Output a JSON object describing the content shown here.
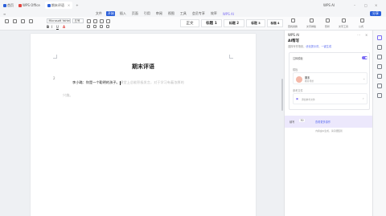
{
  "titlebar": {
    "home": "首页",
    "tabs": [
      {
        "label": "WPS Office"
      },
      {
        "label": "期末评语"
      }
    ],
    "right_text": "WPS AI"
  },
  "menu": {
    "items": [
      "文件",
      "开始",
      "插入",
      "页面",
      "引用",
      "审阅",
      "视图",
      "工具",
      "会员专享",
      "效率",
      "WPS AI"
    ],
    "active_index": 1,
    "share_label": "分享"
  },
  "ribbon": {
    "font_name": "Microsoft YaHei",
    "font_size": "五号",
    "styles": [
      "正文",
      "标题 1",
      "标题 2",
      "标题 3",
      "标题 4"
    ],
    "right_labels": [
      "查找替换",
      "文字排版",
      "形状",
      "文字工具",
      "公式"
    ]
  },
  "document": {
    "title": "期末评语",
    "para_number": "2",
    "line1_text": "李小璐：你是一个聪明的孩子。",
    "line1_ghost": "课堂上总能积极发言，对于学习有着浓厚的",
    "line2_ghost": "兴趣。"
  },
  "panel": {
    "header": "WPS AI",
    "title": "AI帮写",
    "subtitle_prefix": "选择写作场景，",
    "subtitle_link1": "优化提示词",
    "subtitle_link2": "一键生成",
    "card1_label": "注释模板",
    "card1_value": "已开启",
    "card2_label": "模板",
    "card2_title": "期末",
    "card2_sub": "教育场景",
    "card3_label": "参考文件",
    "card3_text": "添加参考文件",
    "footer_left": "续写",
    "footer_mid": "30",
    "footer_link": "查看更多操作",
    "hint": "内容由AI生成，请仔细甄别"
  },
  "colors": {
    "accent": "#2b5fd9",
    "ai_purple": "#7b6cf5",
    "panel_footer": "#ece8fc"
  }
}
